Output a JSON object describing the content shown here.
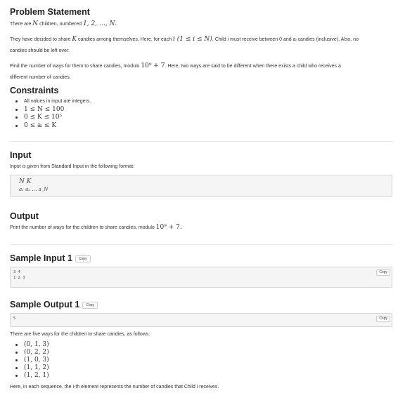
{
  "problem": {
    "title": "Problem Statement",
    "line1_pre": "There are ",
    "line1_var": "N",
    "line1_mid": " children, numbered ",
    "line1_math": "1, 2, …, N.",
    "line2_pre": "They have decided to share ",
    "line2_var": "K",
    "line2_mid": " candies among themselves. Here, for each ",
    "line2_math": "i (1 ≤ i ≤ N)",
    "line2_post": ", Child i must receive between 0 and aᵢ candies (inclusive). Also, no",
    "line3": "candies should be left over.",
    "line4_pre": "Find the number of ways for them to share candies, modulo ",
    "line4_math": "10⁹ + 7",
    "line4_post": ". Here, two ways are said to be different when there exists a child who receives a",
    "line5": "different number of candies."
  },
  "constraints": {
    "title": "Constraints",
    "items": [
      "All values in input are integers.",
      "1 ≤ N ≤ 100",
      "0 ≤ K ≤ 10⁵",
      "0 ≤ aᵢ ≤ K"
    ]
  },
  "input": {
    "title": "Input",
    "desc": "Input is given from Standard Input in the following format:",
    "format_line1": "N  K",
    "format_line2": "a₁  a₂  …  a_N"
  },
  "output": {
    "title": "Output",
    "desc_pre": "Print the number of ways for the children to share candies, modulo ",
    "desc_math": "10⁹ + 7."
  },
  "sample_input_1": {
    "title": "Sample Input 1",
    "copy_label": "Copy",
    "content": "3 4\n1 2 3"
  },
  "sample_output_1": {
    "title": "Sample Output 1",
    "copy_label": "Copy",
    "content": "5",
    "explanation": "There are five ways for the children to share candies, as follows:",
    "ways": [
      "(0, 1, 3)",
      "(0, 2, 2)",
      "(1, 0, 3)",
      "(1, 1, 2)",
      "(1, 2, 1)"
    ],
    "note": "Here, in each sequence, the i-th element represents the number of candies that Child i receives."
  }
}
